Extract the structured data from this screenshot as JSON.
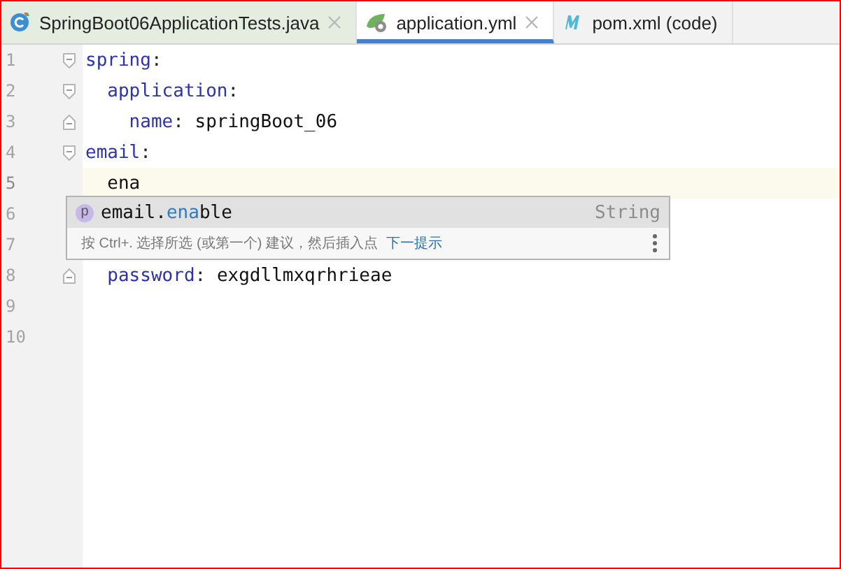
{
  "tabs": [
    {
      "label": "SpringBoot06ApplicationTests.java",
      "kind": "java",
      "closable": true,
      "selected": false
    },
    {
      "label": "application.yml",
      "kind": "yaml",
      "closable": true,
      "selected": true
    },
    {
      "label": "pom.xml (code)",
      "kind": "maven",
      "closable": false,
      "selected": false
    }
  ],
  "lines": [
    {
      "number": "1",
      "kind": "opener",
      "current": false,
      "tokens": [
        {
          "text": "spring",
          "kind": "key"
        },
        {
          "text": ":",
          "kind": "punct"
        }
      ]
    },
    {
      "number": "2",
      "kind": "opener",
      "current": false,
      "tokens": [
        {
          "text": "  application",
          "kind": "key"
        },
        {
          "text": ":",
          "kind": "punct"
        }
      ]
    },
    {
      "number": "3",
      "kind": "closer",
      "current": false,
      "tokens": [
        {
          "text": "    name",
          "kind": "key"
        },
        {
          "text": ": ",
          "kind": "punct"
        },
        {
          "text": "springBoot_06",
          "kind": "value"
        }
      ]
    },
    {
      "number": "4",
      "kind": "opener",
      "current": false,
      "tokens": [
        {
          "text": "email",
          "kind": "key"
        },
        {
          "text": ":",
          "kind": "punct"
        }
      ]
    },
    {
      "number": "5",
      "kind": "plain",
      "current": true,
      "tokens": [
        {
          "text": "  ena",
          "kind": "value"
        }
      ]
    },
    {
      "number": "6",
      "kind": "plain",
      "current": false
    },
    {
      "number": "7",
      "kind": "plain",
      "current": false
    },
    {
      "number": "8",
      "kind": "closer",
      "current": false,
      "tokens": [
        {
          "text": "  password",
          "kind": "key"
        },
        {
          "text": ": ",
          "kind": "punct"
        },
        {
          "text": "exgdllmxqrhrieae",
          "kind": "value"
        }
      ]
    },
    {
      "number": "9",
      "kind": "plain",
      "current": false
    },
    {
      "number": "10",
      "kind": "plain",
      "current": false
    }
  ],
  "popup": {
    "items": [
      {
        "badge": "p",
        "prefix": "email.",
        "match": "ena",
        "rest": "ble",
        "type": "String",
        "selected": true
      }
    ],
    "hint": "按 Ctrl+. 选择所选 (或第一个) 建议，然后插入点",
    "hint_link": "下一提示"
  }
}
